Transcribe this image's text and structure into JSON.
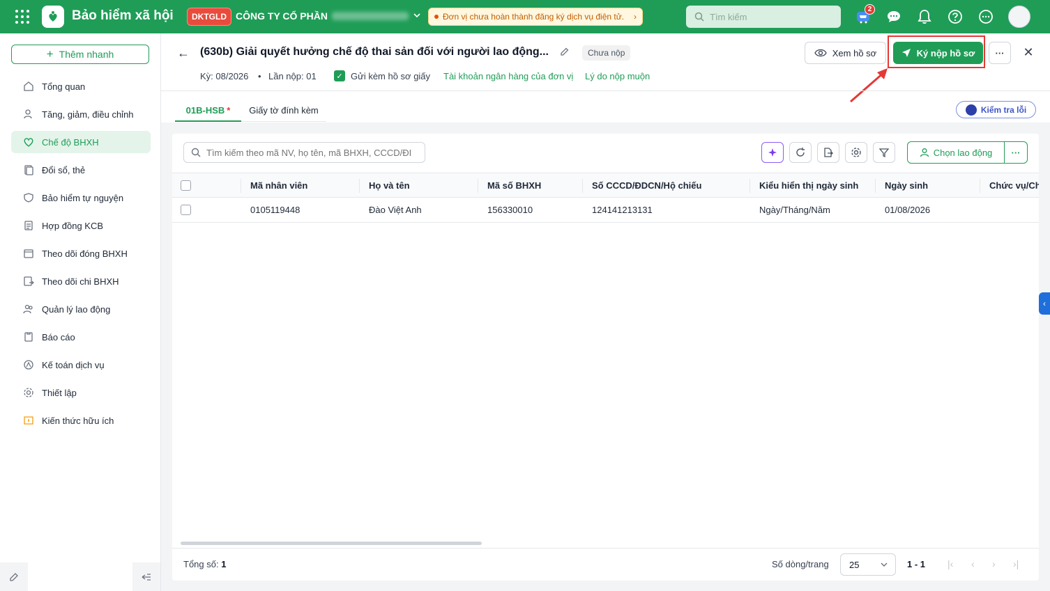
{
  "topbar": {
    "app_title": "Bảo hiểm xã hội",
    "company_badge": "DKTGLD",
    "company_name": "CÔNG TY CỔ PHẦN",
    "notice": "Đơn vị chưa hoàn thành đăng ký dịch vụ điện tử.",
    "search_placeholder": "Tìm kiếm",
    "cart_badge": "2",
    "icons": [
      "apps-icon",
      "cart-icon",
      "chat-icon",
      "bell-icon",
      "help-icon",
      "more-icon"
    ]
  },
  "sidebar": {
    "quick_add": "Thêm nhanh",
    "items": [
      {
        "label": "Tổng quan",
        "icon": "home-icon"
      },
      {
        "label": "Tăng, giảm, điều chỉnh",
        "icon": "user-adjust-icon"
      },
      {
        "label": "Chế độ BHXH",
        "icon": "heart-shield-icon",
        "active": true
      },
      {
        "label": "Đổi sổ, thẻ",
        "icon": "card-swap-icon"
      },
      {
        "label": "Bảo hiểm tự nguyện",
        "icon": "shield-icon"
      },
      {
        "label": "Hợp đồng KCB",
        "icon": "contract-icon"
      },
      {
        "label": "Theo dõi đóng BHXH",
        "icon": "calendar-track-icon"
      },
      {
        "label": "Theo dõi chi BHXH",
        "icon": "payout-track-icon"
      },
      {
        "label": "Quản lý lao động",
        "icon": "people-icon"
      },
      {
        "label": "Báo cáo",
        "icon": "report-icon"
      },
      {
        "label": "Kế toán dịch vụ",
        "icon": "accounting-icon"
      },
      {
        "label": "Thiết lập",
        "icon": "gear-icon"
      },
      {
        "label": "Kiến thức hữu ích",
        "icon": "knowledge-icon"
      }
    ]
  },
  "header": {
    "title": "(630b) Giải quyết hưởng chế độ thai sản đối với người lao động...",
    "status": "Chưa nộp",
    "period": "Kỳ: 08/2026",
    "submission": "Lần nộp: 01",
    "paper_checkbox_label": "Gửi kèm hồ sơ giấy",
    "bank_link": "Tài khoản ngân hàng của đơn vị",
    "late_link": "Lý do nộp muộn",
    "view_button": "Xem hồ sơ",
    "sign_button": "Ký nộp hồ sơ"
  },
  "tabs": [
    {
      "label": "01B-HSB",
      "required": "*"
    },
    {
      "label": "Giấy tờ đính kèm"
    }
  ],
  "check_errors": "Kiểm tra lỗi",
  "grid": {
    "search_placeholder": "Tìm kiếm theo mã NV, họ tên, mã BHXH, CCCD/ĐI",
    "choose_employee": "Chọn lao động",
    "columns": [
      "Mã nhân viên",
      "Họ và tên",
      "Mã số BHXH",
      "Số CCCD/ĐDCN/Hộ chiếu",
      "Kiểu hiển thị ngày sinh",
      "Ngày sinh",
      "Chức vụ/Ch"
    ],
    "rows": [
      [
        "0105119448",
        "Đào Việt Anh",
        "156330010",
        "124141213131",
        "Ngày/Tháng/Năm",
        "01/08/2026",
        ""
      ]
    ]
  },
  "footer": {
    "total_label": "Tổng số:",
    "total_value": "1",
    "rows_per_page_label": "Số dòng/trang",
    "rows_per_page": "25",
    "range": "1 - 1"
  },
  "colors": {
    "brand": "#1f9d57",
    "highlight": "#e53935"
  }
}
